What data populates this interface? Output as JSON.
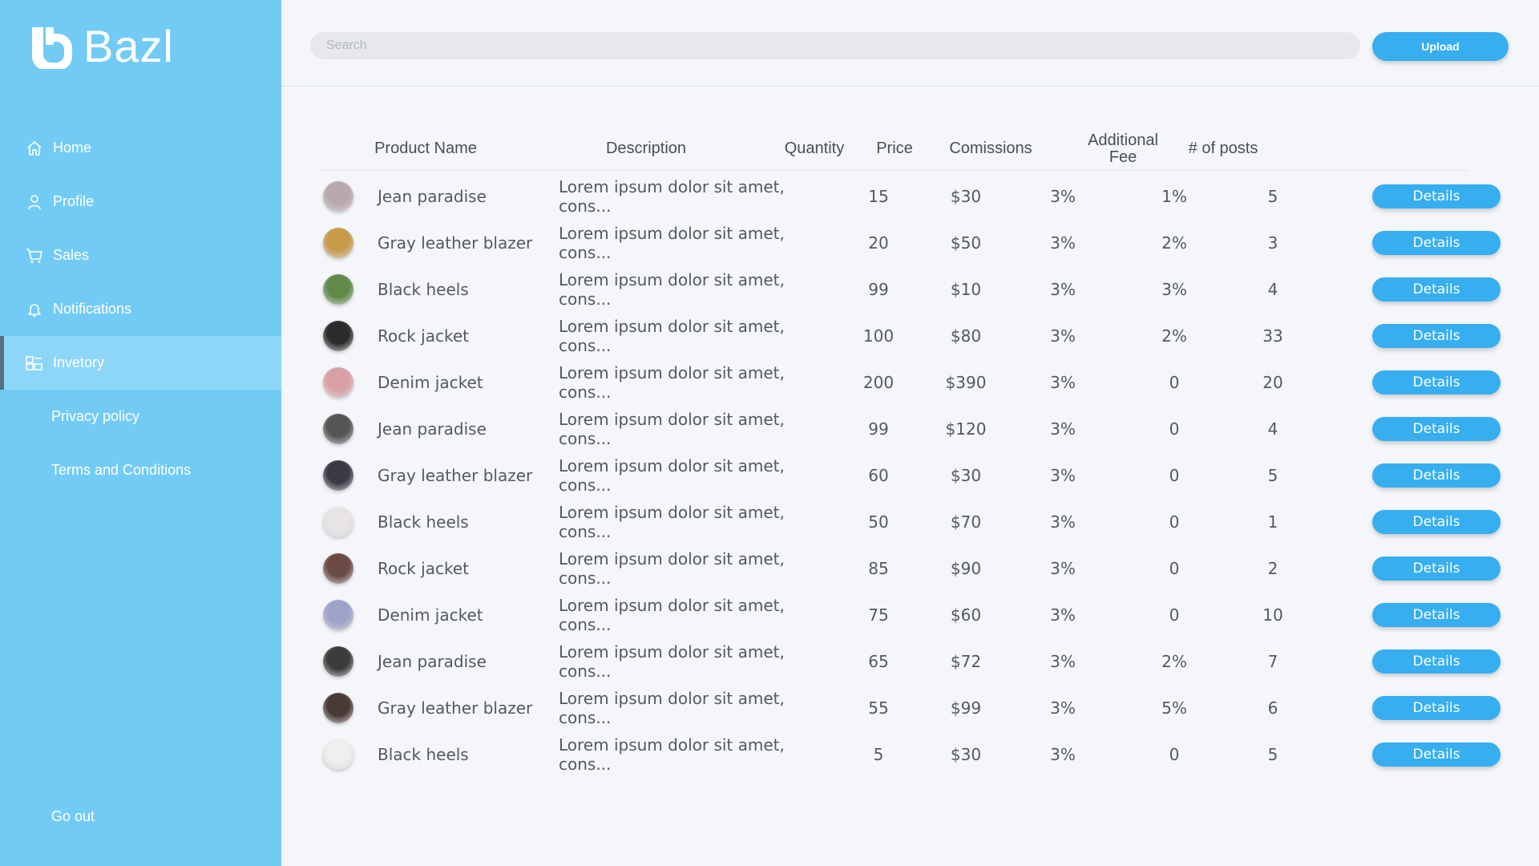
{
  "app": {
    "brand": "Bazl"
  },
  "sidebar": {
    "items": [
      {
        "label": "Home",
        "icon": "home-icon"
      },
      {
        "label": "Profile",
        "icon": "user-icon"
      },
      {
        "label": "Sales",
        "icon": "cart-icon"
      },
      {
        "label": "Notifications",
        "icon": "bell-icon"
      },
      {
        "label": "Invetory",
        "icon": "inventory-icon",
        "active": true
      },
      {
        "label": "Privacy policy"
      },
      {
        "label": "Terms and Conditions"
      }
    ],
    "go_out": "Go out"
  },
  "header": {
    "search_placeholder": "Search",
    "upload_label": "Upload"
  },
  "table": {
    "columns": [
      "Product Name",
      "Description",
      "Quantity",
      "Price",
      "Comissions",
      "Additional Fee",
      "# of posts"
    ],
    "details_label": "Details",
    "rows": [
      {
        "name": "Jean paradise",
        "description": "Lorem ipsum dolor sit amet, cons...",
        "quantity": "15",
        "price": "$30",
        "commission": "3%",
        "fee": "1%",
        "posts": "5",
        "thumb": "#b9a8ae"
      },
      {
        "name": "Gray leather blazer",
        "description": "Lorem ipsum dolor sit amet, cons...",
        "quantity": "20",
        "price": "$50",
        "commission": "3%",
        "fee": "2%",
        "posts": "3",
        "thumb": "#c79a4a"
      },
      {
        "name": "Black heels",
        "description": "Lorem ipsum dolor sit amet, cons...",
        "quantity": "99",
        "price": "$10",
        "commission": "3%",
        "fee": "3%",
        "posts": "4",
        "thumb": "#5f8a4a"
      },
      {
        "name": "Rock jacket",
        "description": "Lorem ipsum dolor sit amet, cons...",
        "quantity": "100",
        "price": "$80",
        "commission": "3%",
        "fee": "2%",
        "posts": "33",
        "thumb": "#2b2b2b"
      },
      {
        "name": "Denim jacket",
        "description": "Lorem ipsum dolor sit amet, cons...",
        "quantity": "200",
        "price": "$390",
        "commission": "3%",
        "fee": "0",
        "posts": "20",
        "thumb": "#d9a0a4"
      },
      {
        "name": "Jean paradise",
        "description": "Lorem ipsum dolor sit amet, cons...",
        "quantity": "99",
        "price": "$120",
        "commission": "3%",
        "fee": "0",
        "posts": "4",
        "thumb": "#555555"
      },
      {
        "name": "Gray leather blazer",
        "description": "Lorem ipsum dolor sit amet, cons...",
        "quantity": "60",
        "price": "$30",
        "commission": "3%",
        "fee": "0",
        "posts": "5",
        "thumb": "#3a3a45"
      },
      {
        "name": "Black heels",
        "description": "Lorem ipsum dolor sit amet, cons...",
        "quantity": "50",
        "price": "$70",
        "commission": "3%",
        "fee": "0",
        "posts": "1",
        "thumb": "#e8e4e6"
      },
      {
        "name": "Rock jacket",
        "description": "Lorem ipsum dolor sit amet, cons...",
        "quantity": "85",
        "price": "$90",
        "commission": "3%",
        "fee": "0",
        "posts": "2",
        "thumb": "#6b4a44"
      },
      {
        "name": "Denim jacket",
        "description": "Lorem ipsum dolor sit amet, cons...",
        "quantity": "75",
        "price": "$60",
        "commission": "3%",
        "fee": "0",
        "posts": "10",
        "thumb": "#9fa2c8"
      },
      {
        "name": "Jean paradise",
        "description": "Lorem ipsum dolor sit amet, cons...",
        "quantity": "65",
        "price": "$72",
        "commission": "3%",
        "fee": "2%",
        "posts": "7",
        "thumb": "#3c3c3c"
      },
      {
        "name": "Gray leather blazer",
        "description": "Lorem ipsum dolor sit amet, cons...",
        "quantity": "55",
        "price": "$99",
        "commission": "3%",
        "fee": "5%",
        "posts": "6",
        "thumb": "#4a3a36"
      },
      {
        "name": "Black heels",
        "description": "Lorem ipsum dolor sit amet, cons...",
        "quantity": "5",
        "price": "$30",
        "commission": "3%",
        "fee": "0",
        "posts": "5",
        "thumb": "#f0eeee"
      }
    ]
  },
  "colors": {
    "sidebar": "#72cbf5",
    "accent": "#36aef0",
    "background": "#f4f6f9"
  }
}
